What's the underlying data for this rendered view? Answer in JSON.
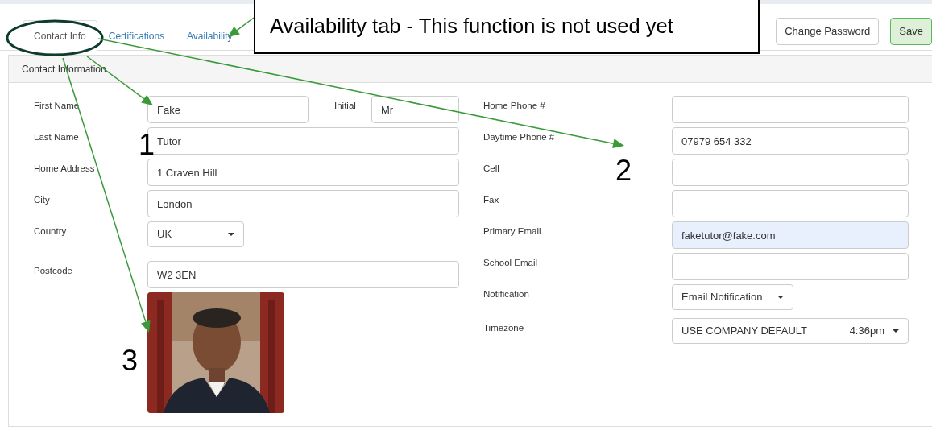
{
  "tabs": [
    {
      "label": "Contact Info",
      "selected": true
    },
    {
      "label": "Certifications",
      "selected": false
    },
    {
      "label": "Availability",
      "selected": false
    }
  ],
  "buttons": [
    {
      "label": "Change Password",
      "kind": "default"
    },
    {
      "label": "Save",
      "kind": "success"
    }
  ],
  "panel": {
    "title": "Contact Information",
    "left_fields": [
      {
        "kind": "pair",
        "label": "First Name",
        "value": "Fake",
        "second_label": "Initial",
        "second_value": "Mr"
      },
      {
        "kind": "text",
        "label": "Last Name",
        "value": "Tutor"
      },
      {
        "kind": "text",
        "label": "Home Address",
        "value": "1 Craven Hill"
      },
      {
        "kind": "text",
        "label": "City",
        "value": "London"
      },
      {
        "kind": "select",
        "label": "Country",
        "value": "UK"
      },
      {
        "kind": "text",
        "label": "Postcode",
        "value": "W2 3EN"
      },
      {
        "kind": "picture"
      }
    ],
    "right_fields": [
      {
        "kind": "text",
        "label": "Home Phone #",
        "autofilled": false
      },
      {
        "kind": "text",
        "label": "Daytime Phone #",
        "value": "07979 654 332",
        "autofilled": false
      },
      {
        "kind": "text",
        "label": "Cell",
        "autofilled": false
      },
      {
        "kind": "text",
        "label": "Fax",
        "autofilled": false
      },
      {
        "kind": "text",
        "label": "Primary Email",
        "value": "faketutor@fake.com",
        "autofilled": true
      },
      {
        "kind": "text",
        "label": "School Email",
        "autofilled": false
      },
      {
        "kind": "select",
        "label": "Notification",
        "value": "Email Notification"
      },
      {
        "kind": "select",
        "label": "Timezone",
        "value": "USE COMPANY DEFAULT",
        "time": "4:36pm"
      }
    ]
  },
  "annotations": {
    "callout": "Availability tab - This function is not used yet",
    "markers": [
      {
        "label": "1"
      },
      {
        "label": "2"
      },
      {
        "label": "3"
      }
    ]
  }
}
